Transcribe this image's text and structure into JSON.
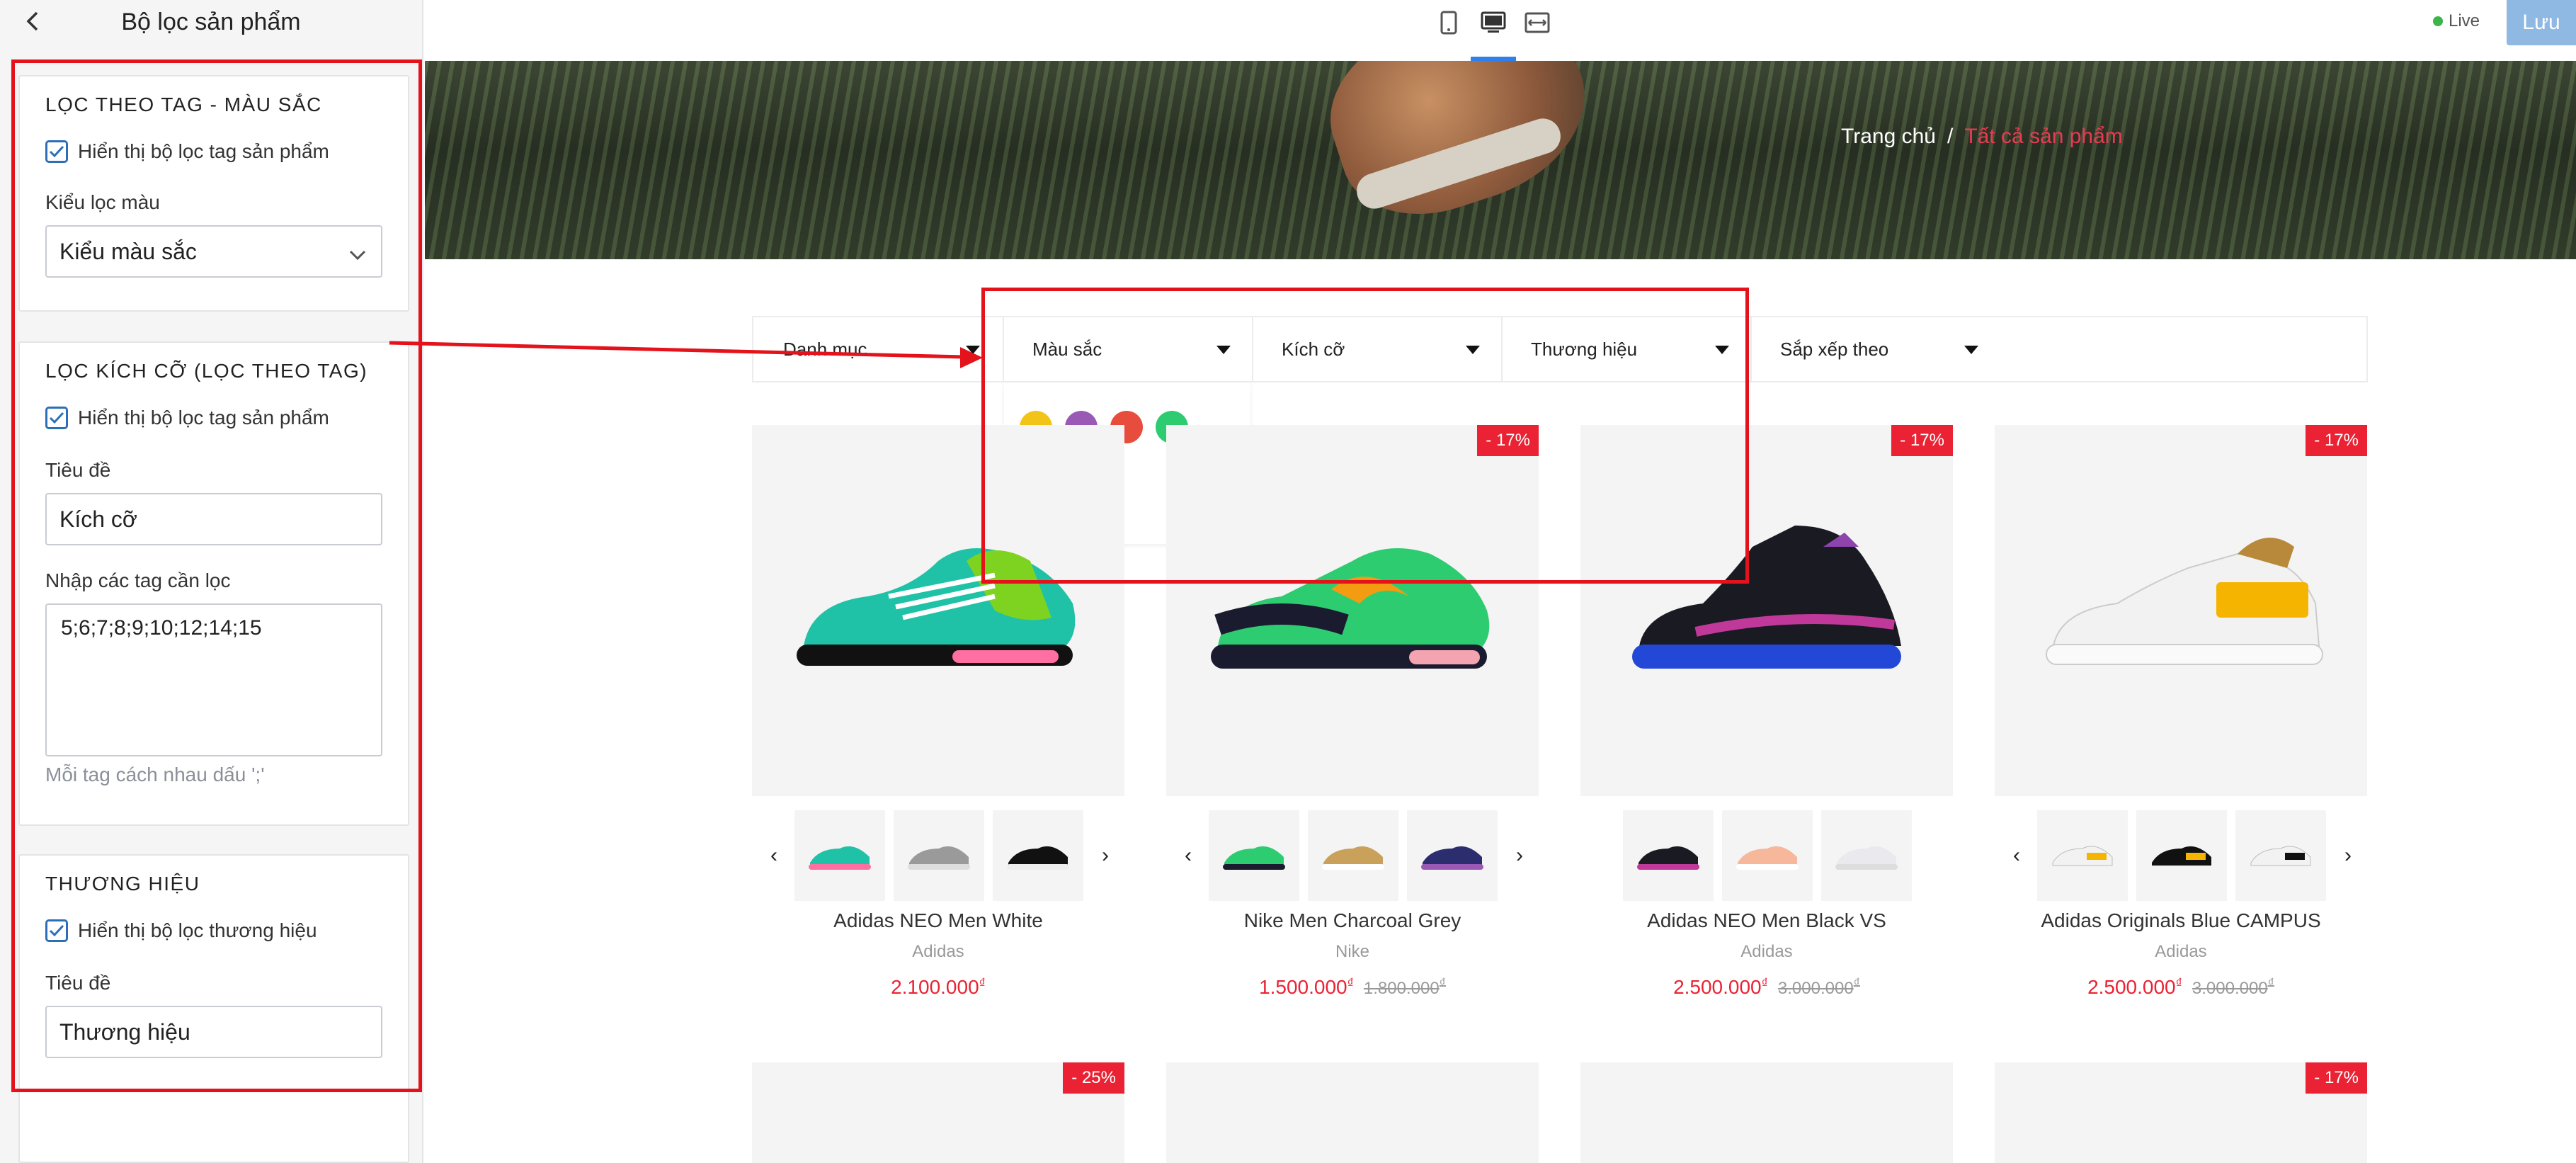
{
  "sidebar": {
    "title": "Bộ lọc sản phẩm",
    "color_section": {
      "heading": "LỌC THEO TAG - MÀU SẮC",
      "checkbox_label": "Hiển thị bộ lọc tag sản phẩm",
      "select_label": "Kiểu lọc màu",
      "select_value": "Kiểu màu sắc"
    },
    "size_section": {
      "heading": "LỌC KÍCH CỠ (LỌC THEO TAG)",
      "checkbox_label": "Hiển thị bộ lọc tag sản phẩm",
      "title_label": "Tiêu đề",
      "title_value": "Kích cỡ",
      "tags_label": "Nhập các tag cần lọc",
      "tags_value": "5;6;7;8;9;10;12;14;15",
      "hint": "Mỗi tag cách nhau dấu ';'"
    },
    "brand_section": {
      "heading": "THƯƠNG HIỆU",
      "checkbox_label": "Hiển thị bộ lọc thương hiệu",
      "title_label": "Tiêu đề",
      "title_value": "Thương hiệu"
    }
  },
  "topbar": {
    "live_label": "Live",
    "save_label": "Lưu",
    "accent": "#2f80ed"
  },
  "breadcrumb": {
    "home": "Trang chủ",
    "separator": "/",
    "current": "Tất cả sản phẩm"
  },
  "filters": {
    "category": "Danh mục",
    "color": "Màu sắc",
    "size": "Kích cỡ",
    "brand": "Thương hiệu",
    "sort": "Sắp xếp theo"
  },
  "color_swatches": [
    "#f2c418",
    "#9b59b6",
    "#e74c3c",
    "#2ecc71",
    "#ff00cc",
    "#e67e22"
  ],
  "products": [
    {
      "name": "Adidas NEO Men White",
      "brand": "Adidas",
      "price": "2.100.000",
      "old_price": "",
      "badge": "",
      "currency": "₫"
    },
    {
      "name": "Nike Men Charcoal Grey",
      "brand": "Nike",
      "price": "1.500.000",
      "old_price": "1.800.000",
      "badge": "- 17%",
      "currency": "₫"
    },
    {
      "name": "Adidas NEO Men Black VS",
      "brand": "Adidas",
      "price": "2.500.000",
      "old_price": "3.000.000",
      "badge": "- 17%",
      "currency": "₫"
    },
    {
      "name": "Adidas Originals Blue CAMPUS",
      "brand": "Adidas",
      "price": "2.500.000",
      "old_price": "3.000.000",
      "badge": "- 17%",
      "currency": "₫"
    }
  ],
  "second_row_badges": [
    "- 25%",
    "",
    "",
    "- 17%"
  ]
}
